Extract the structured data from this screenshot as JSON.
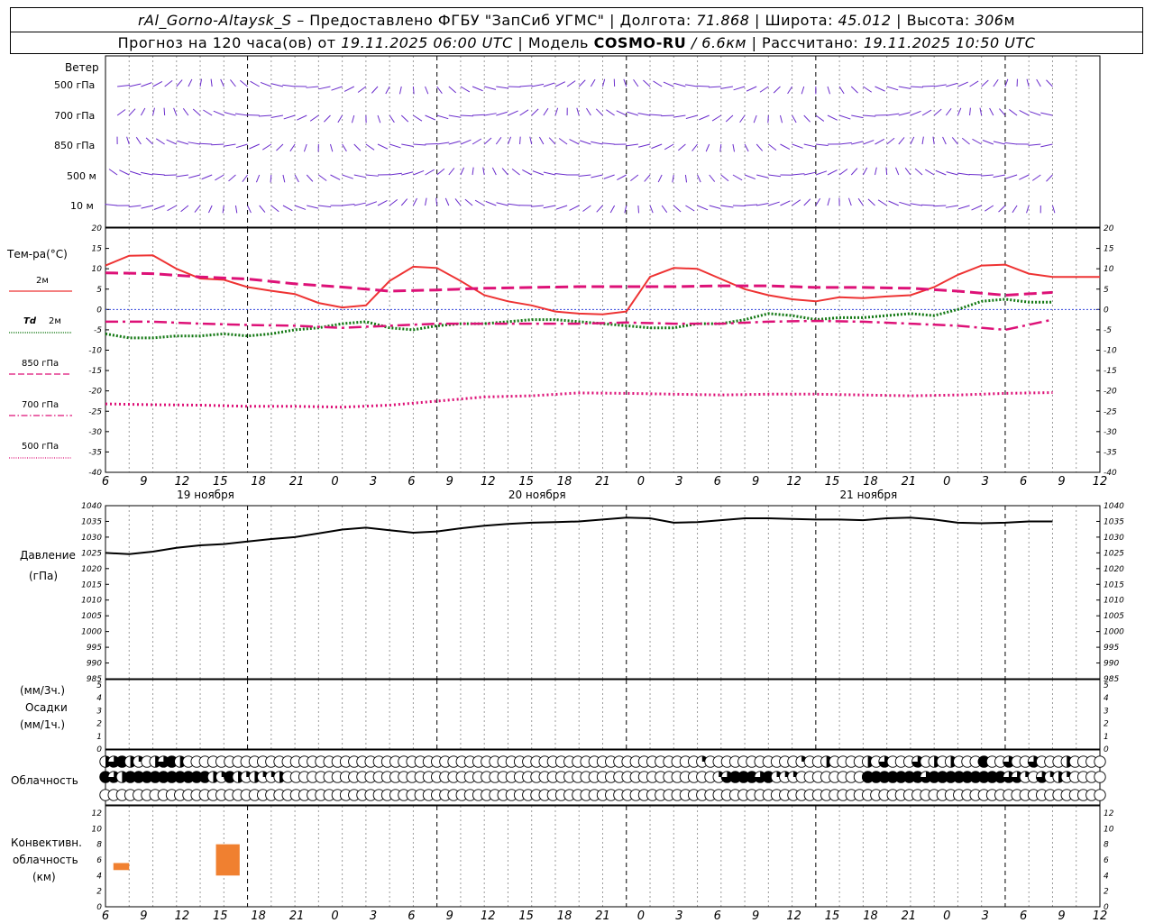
{
  "header": {
    "station": "rAl_Gorno-Altaysk_S",
    "provided_label": "– Предоставлено ФГБУ \"ЗапСиб УГМС\"",
    "lon_label": "Долгота:",
    "lon_value": "71.868",
    "lat_label": "Широта:",
    "lat_value": "45.012",
    "alt_label": "Высота:",
    "alt_value": "306",
    "alt_unit": "м",
    "forecast_label": "Прогноз на 120 часа(ов) от",
    "forecast_start": "19.11.2025 06:00 UTC",
    "model_label": "Модель",
    "model_name": "COSMO-RU",
    "model_res": "/ 6.6км",
    "calc_label": "Рассчитано:",
    "calc_time": "19.11.2025 10:50 UTC"
  },
  "wind_panel": {
    "title": "Ветер",
    "levels": [
      "500 гПа",
      "700 гПа",
      "850 гПа",
      "500 м",
      "10 м"
    ]
  },
  "temp_panel": {
    "title": "Тем-ра(°C)",
    "legend": [
      {
        "label": "2м",
        "color": "#ee3333",
        "style": "solid"
      },
      {
        "label": "Td",
        "label2": "2м",
        "color": "#117711",
        "style": "dotted"
      },
      {
        "label": "850 гПа",
        "color": "#dd1177",
        "style": "dashed"
      },
      {
        "label": "700 гПа",
        "color": "#dd1177",
        "style": "dashdot"
      },
      {
        "label": "500 гПа",
        "color": "#dd1177",
        "style": "densedot"
      }
    ],
    "yticks": [
      "20",
      "15",
      "10",
      "5",
      "0",
      "-5",
      "-10",
      "-15",
      "-20",
      "-25",
      "-30",
      "-35",
      "-40"
    ]
  },
  "time_axis": {
    "hour_ticks": [
      "6",
      "9",
      "12",
      "15",
      "18",
      "21",
      "0",
      "3",
      "6",
      "9",
      "12",
      "15",
      "18",
      "21",
      "0",
      "3",
      "6",
      "9",
      "12",
      "15",
      "18",
      "21",
      "0",
      "3",
      "6",
      "9",
      "12"
    ],
    "days": [
      "19 ноября",
      "20 ноября",
      "21 ноября"
    ]
  },
  "pressure_panel": {
    "title": "Давление",
    "unit": "(гПа)",
    "yticks": [
      "1040",
      "1035",
      "1030",
      "1025",
      "1020",
      "1015",
      "1010",
      "1005",
      "1000",
      "995",
      "990",
      "985"
    ]
  },
  "precip_panel": {
    "unit1": "(мм/3ч.)",
    "title": "Осадки",
    "unit2": "(мм/1ч.)",
    "yticks": [
      "5",
      "4",
      "3",
      "2",
      "1",
      "0"
    ]
  },
  "cloud_panel": {
    "title": "Облачность"
  },
  "conv_panel": {
    "title1": "Конвективн.",
    "title2": "облачность",
    "unit": "(км)",
    "yticks": [
      "12",
      "10",
      "8",
      "6",
      "4",
      "2",
      "0"
    ]
  },
  "chart_data": {
    "type": "line",
    "x_unit": "hours since 19.11.2025 06:00 UTC",
    "temperature": {
      "ylim": [
        -40,
        20
      ],
      "series": [
        {
          "name": "2м",
          "color": "#ee3333",
          "x": [
            0,
            3,
            6,
            9,
            12,
            15,
            18,
            21,
            24,
            27,
            30,
            33,
            36,
            39,
            42,
            45,
            48,
            51,
            54,
            57,
            60,
            63,
            66,
            69,
            72,
            75,
            78,
            81,
            84,
            87,
            90,
            93,
            96,
            99,
            102,
            105,
            108,
            111,
            114,
            117,
            120,
            123,
            126
          ],
          "y": [
            10.8,
            13.2,
            13.3,
            10.0,
            7.6,
            7.3,
            5.5,
            4.6,
            3.8,
            1.6,
            0.5,
            1.0,
            7.0,
            10.5,
            10.2,
            7.0,
            3.5,
            2.0,
            1.0,
            -0.5,
            -1.0,
            -1.2,
            -0.5,
            8.0,
            10.2,
            10.0,
            7.5,
            5.0,
            3.5,
            2.5,
            2.0,
            3.0,
            2.8,
            3.2,
            3.5,
            5.5,
            8.5,
            10.8,
            11.0,
            8.8,
            8.0,
            8.0,
            8.0
          ]
        },
        {
          "name": "Td 2м",
          "color": "#117711",
          "x": [
            0,
            3,
            6,
            9,
            12,
            15,
            18,
            21,
            24,
            27,
            30,
            33,
            36,
            39,
            42,
            45,
            48,
            51,
            54,
            57,
            60,
            63,
            66,
            69,
            72,
            75,
            78,
            81,
            84,
            87,
            90,
            93,
            96,
            99,
            102,
            105,
            108,
            111,
            114,
            117,
            120
          ],
          "y": [
            -6.0,
            -7.0,
            -7.0,
            -6.5,
            -6.5,
            -6.0,
            -6.5,
            -6.0,
            -5.0,
            -4.5,
            -3.5,
            -3.0,
            -4.5,
            -5.0,
            -4.0,
            -3.5,
            -3.5,
            -3.0,
            -2.5,
            -2.5,
            -3.0,
            -3.5,
            -4.0,
            -4.5,
            -4.5,
            -3.5,
            -3.5,
            -2.5,
            -1.0,
            -1.5,
            -2.5,
            -2.0,
            -2.0,
            -1.5,
            -1.0,
            -1.5,
            0.0,
            2.0,
            2.5,
            1.8,
            1.8
          ]
        },
        {
          "name": "850 гПа",
          "color": "#dd1177",
          "x": [
            0,
            6,
            12,
            18,
            24,
            30,
            36,
            42,
            48,
            54,
            60,
            66,
            72,
            78,
            84,
            90,
            96,
            102,
            108,
            114,
            120
          ],
          "y": [
            9.0,
            8.8,
            8.0,
            7.5,
            6.3,
            5.5,
            4.5,
            4.8,
            5.2,
            5.4,
            5.6,
            5.6,
            5.6,
            5.8,
            5.8,
            5.4,
            5.4,
            5.2,
            4.5,
            3.5,
            4.2
          ]
        },
        {
          "name": "700 гПа",
          "color": "#dd1177",
          "x": [
            0,
            6,
            12,
            18,
            24,
            30,
            36,
            42,
            48,
            54,
            60,
            66,
            72,
            78,
            84,
            90,
            96,
            102,
            108,
            114,
            120
          ],
          "y": [
            -3.0,
            -3.0,
            -3.5,
            -3.8,
            -4.0,
            -4.5,
            -4.0,
            -3.5,
            -3.5,
            -3.5,
            -3.5,
            -3.2,
            -3.5,
            -3.5,
            -3.0,
            -2.8,
            -3.0,
            -3.5,
            -4.0,
            -5.0,
            -2.5
          ]
        },
        {
          "name": "500 гПа",
          "color": "#dd1177",
          "x": [
            0,
            6,
            12,
            18,
            24,
            30,
            36,
            42,
            48,
            54,
            60,
            66,
            72,
            78,
            84,
            90,
            96,
            102,
            108,
            114,
            120
          ],
          "y": [
            -23.2,
            -23.4,
            -23.5,
            -23.8,
            -23.8,
            -24.0,
            -23.5,
            -22.5,
            -21.5,
            -21.2,
            -20.5,
            -20.6,
            -20.8,
            -21.0,
            -20.8,
            -20.8,
            -21.0,
            -21.2,
            -21.0,
            -20.6,
            -20.4
          ]
        }
      ]
    },
    "pressure": {
      "ylim": [
        985,
        1040
      ],
      "series": [
        {
          "name": "Давление",
          "color": "#000000",
          "x": [
            0,
            3,
            6,
            9,
            12,
            15,
            18,
            21,
            24,
            27,
            30,
            33,
            36,
            39,
            42,
            45,
            48,
            51,
            54,
            57,
            60,
            63,
            66,
            69,
            72,
            75,
            78,
            81,
            84,
            87,
            90,
            93,
            96,
            99,
            102,
            105,
            108,
            111,
            114,
            117,
            120
          ],
          "y": [
            1025.0,
            1024.6,
            1025.4,
            1026.6,
            1027.4,
            1027.8,
            1028.6,
            1029.4,
            1030.0,
            1031.2,
            1032.4,
            1033.0,
            1032.2,
            1031.4,
            1031.8,
            1032.8,
            1033.6,
            1034.2,
            1034.6,
            1034.8,
            1035.0,
            1035.6,
            1036.2,
            1036.0,
            1034.6,
            1034.8,
            1035.4,
            1036.0,
            1036.0,
            1035.8,
            1035.6,
            1035.6,
            1035.4,
            1036.0,
            1036.2,
            1035.6,
            1034.6,
            1034.4,
            1034.6,
            1035.0,
            1035.0
          ]
        }
      ]
    },
    "precipitation": {
      "ylim": [
        0,
        5
      ],
      "values": []
    },
    "convective_cloud": {
      "ylim": [
        0,
        12
      ],
      "bars": [
        {
          "x0": 1.0,
          "x1": 3.0,
          "bottom": 4.7,
          "top": 5.6
        },
        {
          "x0": 14.0,
          "x1": 17.0,
          "bottom": 4.0,
          "top": 8.0
        }
      ],
      "color": "#f08030"
    },
    "cloudiness": {
      "rows": [
        {
          "name": "upper",
          "values": [
            0.5,
            0.75,
            1,
            0.5,
            0.25,
            0,
            0.5,
            0.75,
            1,
            0.5,
            0,
            0,
            0,
            0,
            0,
            0,
            0,
            0,
            0,
            0,
            0,
            0,
            0,
            0,
            0,
            0,
            0,
            0,
            0,
            0,
            0,
            0,
            0,
            0,
            0,
            0,
            0,
            0,
            0,
            0,
            0,
            0,
            0,
            0,
            0,
            0,
            0,
            0,
            0,
            0,
            0,
            0,
            0,
            0,
            0,
            0,
            0,
            0,
            0,
            0,
            0,
            0,
            0,
            0,
            0,
            0,
            0,
            0,
            0,
            0,
            0,
            0,
            0.25,
            0,
            0,
            0,
            0,
            0,
            0,
            0,
            0,
            0,
            0,
            0,
            0.25,
            0,
            0,
            0.5,
            0,
            0,
            0,
            0,
            0.5,
            0,
            0.75,
            0,
            0,
            0,
            0.75,
            0,
            0.5,
            0,
            0.5,
            0,
            0,
            0,
            1,
            0,
            0,
            0.75,
            0,
            0,
            0.75,
            0,
            0,
            0,
            0.5,
            0,
            0,
            0,
            0,
            0.5,
            0,
            0,
            1
          ]
        },
        {
          "name": "middle",
          "values": [
            1,
            0.75,
            0.5,
            1,
            1,
            1,
            1,
            1,
            1,
            1,
            1,
            1,
            1,
            0.5,
            0.25,
            1,
            0.5,
            0.25,
            0.5,
            0.25,
            0.25,
            0.5,
            0,
            0,
            0,
            0,
            0,
            0,
            0,
            0,
            0,
            0,
            0,
            0,
            0,
            0,
            0,
            0,
            0,
            0,
            0,
            0,
            0,
            0,
            0,
            0,
            0,
            0,
            0,
            0,
            0,
            0,
            0,
            0,
            0,
            0,
            0,
            0,
            0,
            0,
            0,
            0,
            0,
            0,
            0,
            0,
            0,
            0,
            0,
            0,
            0,
            0,
            0,
            0,
            0.25,
            0.75,
            1,
            1,
            1,
            0.75,
            1,
            0.25,
            0.25,
            0.25,
            0,
            0,
            0,
            0,
            0,
            0,
            0,
            0,
            1,
            1,
            1,
            1,
            1,
            1,
            1,
            0.75,
            1,
            1,
            1,
            1,
            1,
            1,
            1,
            1,
            1,
            0.75,
            0.75,
            0.25,
            0,
            0.75,
            0.25,
            0.5,
            0.25,
            0,
            0,
            0,
            0,
            0,
            0.75
          ]
        },
        {
          "name": "lower",
          "values": []
        }
      ]
    }
  }
}
